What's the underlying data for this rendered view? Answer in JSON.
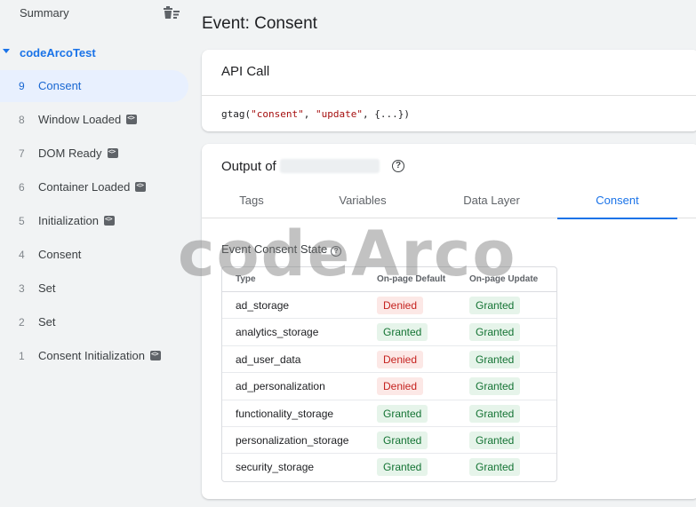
{
  "sidebar": {
    "summary_label": "Summary",
    "container_name": "codeArcoTest",
    "events": [
      {
        "num": "9",
        "label": "Consent",
        "code_badge": false,
        "active": true
      },
      {
        "num": "8",
        "label": "Window Loaded",
        "code_badge": true,
        "active": false
      },
      {
        "num": "7",
        "label": "DOM Ready",
        "code_badge": true,
        "active": false
      },
      {
        "num": "6",
        "label": "Container Loaded",
        "code_badge": true,
        "active": false
      },
      {
        "num": "5",
        "label": "Initialization",
        "code_badge": true,
        "active": false
      },
      {
        "num": "4",
        "label": "Consent",
        "code_badge": false,
        "active": false
      },
      {
        "num": "3",
        "label": "Set",
        "code_badge": false,
        "active": false
      },
      {
        "num": "2",
        "label": "Set",
        "code_badge": false,
        "active": false
      },
      {
        "num": "1",
        "label": "Consent Initialization",
        "code_badge": true,
        "active": false
      }
    ]
  },
  "main": {
    "title": "Event: Consent",
    "api_call": {
      "header": "API Call",
      "code_fn": "gtag(",
      "code_arg1": "\"consent\"",
      "code_sep": ", ",
      "code_arg2": "\"update\"",
      "code_rest": ", {...})"
    },
    "output": {
      "title_prefix": "Output of",
      "help_glyph": "?",
      "tabs": [
        {
          "label": "Tags",
          "active": false
        },
        {
          "label": "Variables",
          "active": false
        },
        {
          "label": "Data Layer",
          "active": false
        },
        {
          "label": "Consent",
          "active": true
        }
      ],
      "section_title": "Event Consent State",
      "table": {
        "headers": [
          "Type",
          "On-page Default",
          "On-page Update"
        ],
        "rows": [
          {
            "type": "ad_storage",
            "default": "Denied",
            "update": "Granted"
          },
          {
            "type": "analytics_storage",
            "default": "Granted",
            "update": "Granted"
          },
          {
            "type": "ad_user_data",
            "default": "Denied",
            "update": "Granted"
          },
          {
            "type": "ad_personalization",
            "default": "Denied",
            "update": "Granted"
          },
          {
            "type": "functionality_storage",
            "default": "Granted",
            "update": "Granted"
          },
          {
            "type": "personalization_storage",
            "default": "Granted",
            "update": "Granted"
          },
          {
            "type": "security_storage",
            "default": "Granted",
            "update": "Granted"
          }
        ]
      }
    }
  },
  "watermark": "codeArco",
  "colors": {
    "accent": "#1a73e8",
    "active_bg": "#e8f0fe",
    "denied_bg": "#fce8e6",
    "denied_text": "#c5221f",
    "granted_bg": "#e6f4ea",
    "granted_text": "#137333"
  },
  "icons": {
    "summary_action": "delete-sweep-icon",
    "event_badge": "code-icon",
    "help": "help-circle-icon"
  }
}
